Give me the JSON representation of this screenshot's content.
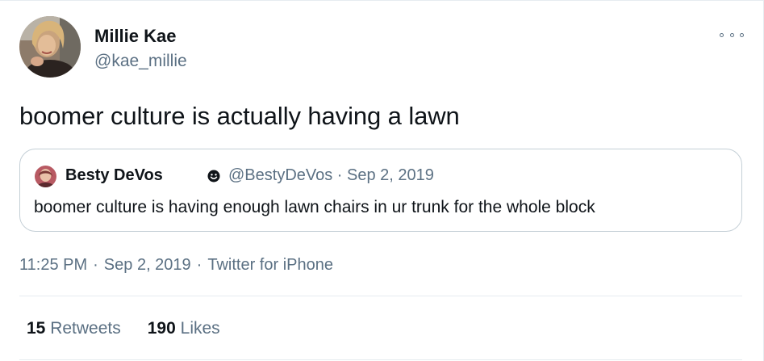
{
  "author": {
    "display_name": "Millie Kae",
    "handle": "@kae_millie"
  },
  "tweet": {
    "text": "boomer culture is actually having a lawn",
    "time": "11:25 PM",
    "date": "Sep 2, 2019",
    "source": "Twitter for iPhone",
    "separator": "·"
  },
  "quoted_tweet": {
    "display_name": "Besty DeVos",
    "badge_icon": "smiley-icon",
    "handle": "@BestyDeVos",
    "date": "Sep 2, 2019",
    "meta": "@BestyDeVos · Sep 2, 2019",
    "text": "boomer culture is having enough lawn chairs in ur trunk for the whole block"
  },
  "stats": {
    "retweets_count": "15",
    "retweets_label": "Retweets",
    "likes_count": "190",
    "likes_label": "Likes"
  },
  "icons": {
    "more": "more-options-icon"
  },
  "colors": {
    "primary_text": "#0f1419",
    "secondary_text": "#5b7083",
    "border": "#c4cfd6",
    "divider": "#e6ecf0"
  }
}
